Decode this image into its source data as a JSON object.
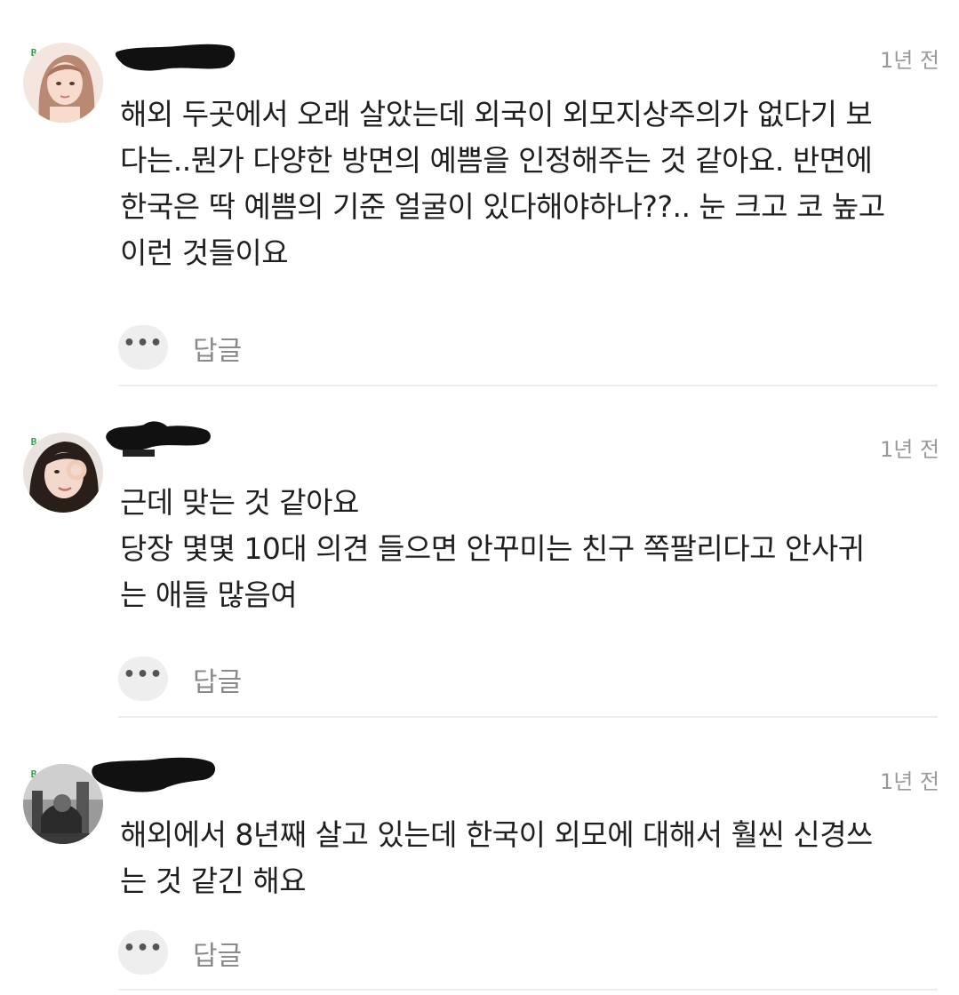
{
  "comments": [
    {
      "badge": "B",
      "timestamp": "1년 전",
      "text": "해외 두곳에서 오래 살았는데 외국이 외모지상주의가 없다기 보\n다는..뭔가 다양한 방면의 예쁨을 인정해주는 것 같아요. 반면에\n한국은 딱 예쁨의 기준 얼굴이 있다해야하나??.. 눈 크고 코 높고\n이런 것들이요",
      "more_icon": "•••",
      "reply_label": "답글",
      "avatar": "avatar-photo-woman"
    },
    {
      "badge": "B",
      "timestamp": "1년 전",
      "text": "근데 맞는 것 같아요\n당장 몇몇 10대 의견 들으면 안꾸미는 친구 쪽팔리다고 안사귀\n는 애들 많음여",
      "more_icon": "•••",
      "reply_label": "답글",
      "avatar": "avatar-photo-woman-wink"
    },
    {
      "badge": "B",
      "timestamp": "1년 전",
      "text": "해외에서 8년째 살고 있는데 한국이 외모에 대해서 훨씬 신경쓰\n는 것 같긴 해요",
      "more_icon": "•••",
      "reply_label": "답글",
      "avatar": "avatar-photo-grayscale"
    }
  ],
  "colors": {
    "badge": "#2e9e4f",
    "timestamp": "#9a9a9a",
    "reply": "#8a8a8a",
    "more_bg": "#eeeeee",
    "divider": "#ececec",
    "redaction": "#111111"
  }
}
